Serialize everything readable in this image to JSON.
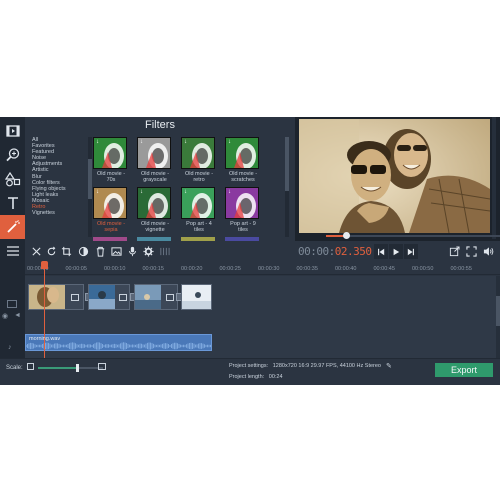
{
  "filters_panel": {
    "title": "Filters",
    "categories": [
      "All",
      "Favorites",
      "Featured",
      "Noise",
      "Adjustments",
      "Artistic",
      "Blur",
      "Color filters",
      "Flying objects",
      "Light leaks",
      "Mosaic",
      "Retro",
      "Vignettes"
    ],
    "selected_category": "Retro",
    "tiles": [
      {
        "label": "Old movie - 70s",
        "color": "#2f8a3a",
        "selected": false
      },
      {
        "label": "Old movie - grayscale",
        "color": "#9a9a9a",
        "selected": false
      },
      {
        "label": "Old movie - retro",
        "color": "#3a7a3a",
        "selected": false
      },
      {
        "label": "Old movie - scratches",
        "color": "#2f8a3a",
        "selected": false
      },
      {
        "label": "Old movie - sepia",
        "color": "#b08a50",
        "selected": true
      },
      {
        "label": "Old movie - vignette",
        "color": "#2a6a36",
        "selected": false
      },
      {
        "label": "Pop art - 4 tiles",
        "color": "#3aa05a",
        "selected": false
      },
      {
        "label": "Pop art - 9 tiles",
        "color": "#8a3aa0",
        "selected": false
      }
    ]
  },
  "left_tools": [
    {
      "name": "import-icon",
      "active": false
    },
    {
      "name": "zoom-icon",
      "active": false
    },
    {
      "name": "shapes-icon",
      "active": false
    },
    {
      "name": "text-icon",
      "active": false
    },
    {
      "name": "filter-wand-icon",
      "active": true
    },
    {
      "name": "menu-icon",
      "active": false
    }
  ],
  "player": {
    "time_prefix": "00:00:",
    "time_value": "02.350",
    "progress": 0.1
  },
  "ruler_ticks": [
    "00:00:00",
    "00:00:05",
    "00:00:10",
    "00:00:15",
    "00:00:20",
    "00:00:25",
    "00:00:30",
    "00:00:35",
    "00:00:40",
    "00:00:45",
    "00:00:50",
    "00:00:55"
  ],
  "audio_clip": {
    "label": "morning.wav"
  },
  "bottom": {
    "scale_label": "Scale:",
    "project_settings_label": "Project settings:",
    "project_settings_value": "1280x720 16:9 29.97 FPS, 44100 Hz Stereo",
    "project_length_label": "Project length:",
    "project_length_value": "00:24",
    "export_label": "Export"
  }
}
